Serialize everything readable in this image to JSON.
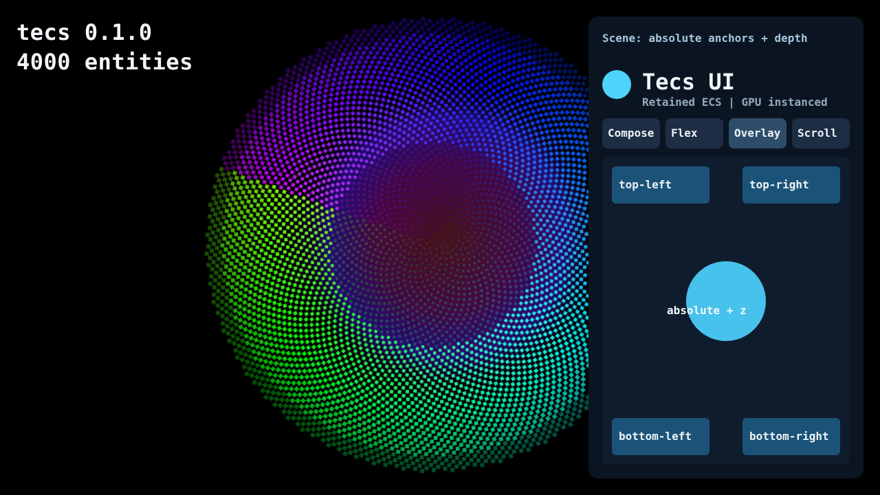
{
  "hud": {
    "version": "tecs 0.1.0",
    "entities": "4000 entities"
  },
  "panel": {
    "scene_label": "Scene: absolute anchors + depth",
    "title": "Tecs UI",
    "subtitle": "Retained ECS | GPU instanced",
    "logo_color": "#4ed4fb",
    "tabs": [
      {
        "label": "Compose",
        "active": false
      },
      {
        "label": "Flex",
        "active": false
      },
      {
        "label": "Overlay",
        "active": true
      },
      {
        "label": "Scroll",
        "active": false
      }
    ],
    "demo": {
      "top_left": "top-left",
      "top_right": "top-right",
      "bottom_left": "bottom-left",
      "bottom_right": "bottom-right",
      "center_label": "absolute + z",
      "center_color": "#47c2ed"
    }
  },
  "colors": {
    "background": "#000000",
    "panel_bg": "#0b1522",
    "tab_bg": "#1c2d44",
    "tab_active_bg": "#2e4d6a",
    "anchor_bg": "#1b5378"
  }
}
